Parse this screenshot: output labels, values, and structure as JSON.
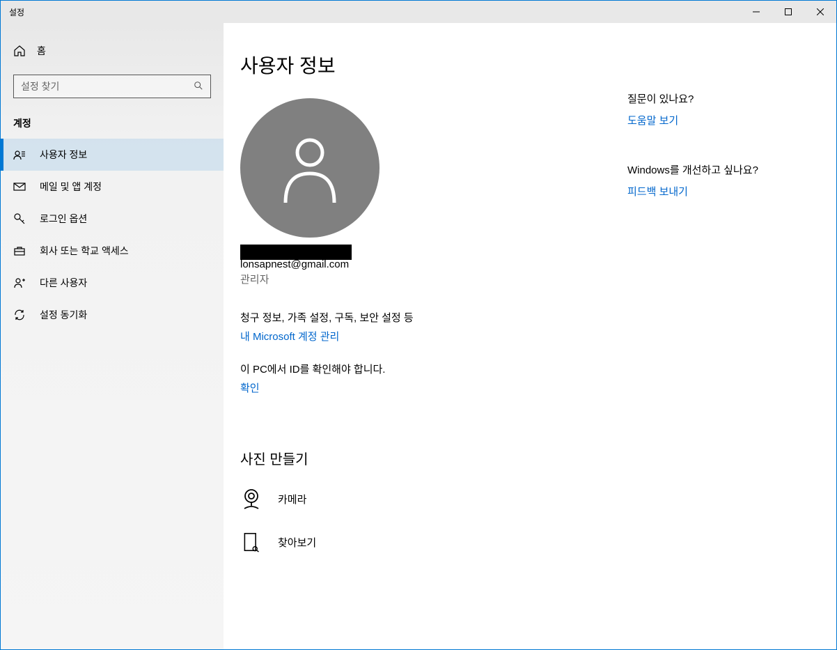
{
  "window": {
    "title": "설정"
  },
  "sidebar": {
    "home": "홈",
    "searchPlaceholder": "설정 찾기",
    "section": "계정",
    "items": [
      {
        "label": "사용자 정보",
        "icon": "user-badge-icon"
      },
      {
        "label": "메일 및 앱 계정",
        "icon": "mail-icon"
      },
      {
        "label": "로그인 옵션",
        "icon": "key-icon"
      },
      {
        "label": "회사 또는 학교 액세스",
        "icon": "briefcase-icon"
      },
      {
        "label": "다른 사용자",
        "icon": "users-icon"
      },
      {
        "label": "설정 동기화",
        "icon": "sync-icon"
      }
    ]
  },
  "main": {
    "title": "사용자 정보",
    "email": "lonsapnest@gmail.com",
    "role": "관리자",
    "billingDesc": "청구 정보, 가족 설정, 구독, 보안 설정 등",
    "manageLink": "내 Microsoft 계정 관리",
    "verifyDesc": "이 PC에서 ID를 확인해야 합니다.",
    "verifyLink": "확인",
    "photoSection": "사진 만들기",
    "cameraLabel": "카메라",
    "browseLabel": "찾아보기"
  },
  "aside": {
    "helpHeading": "질문이 있나요?",
    "helpLink": "도움말 보기",
    "improveHeading": "Windows를 개선하고 싶나요?",
    "improveLink": "피드백 보내기"
  }
}
